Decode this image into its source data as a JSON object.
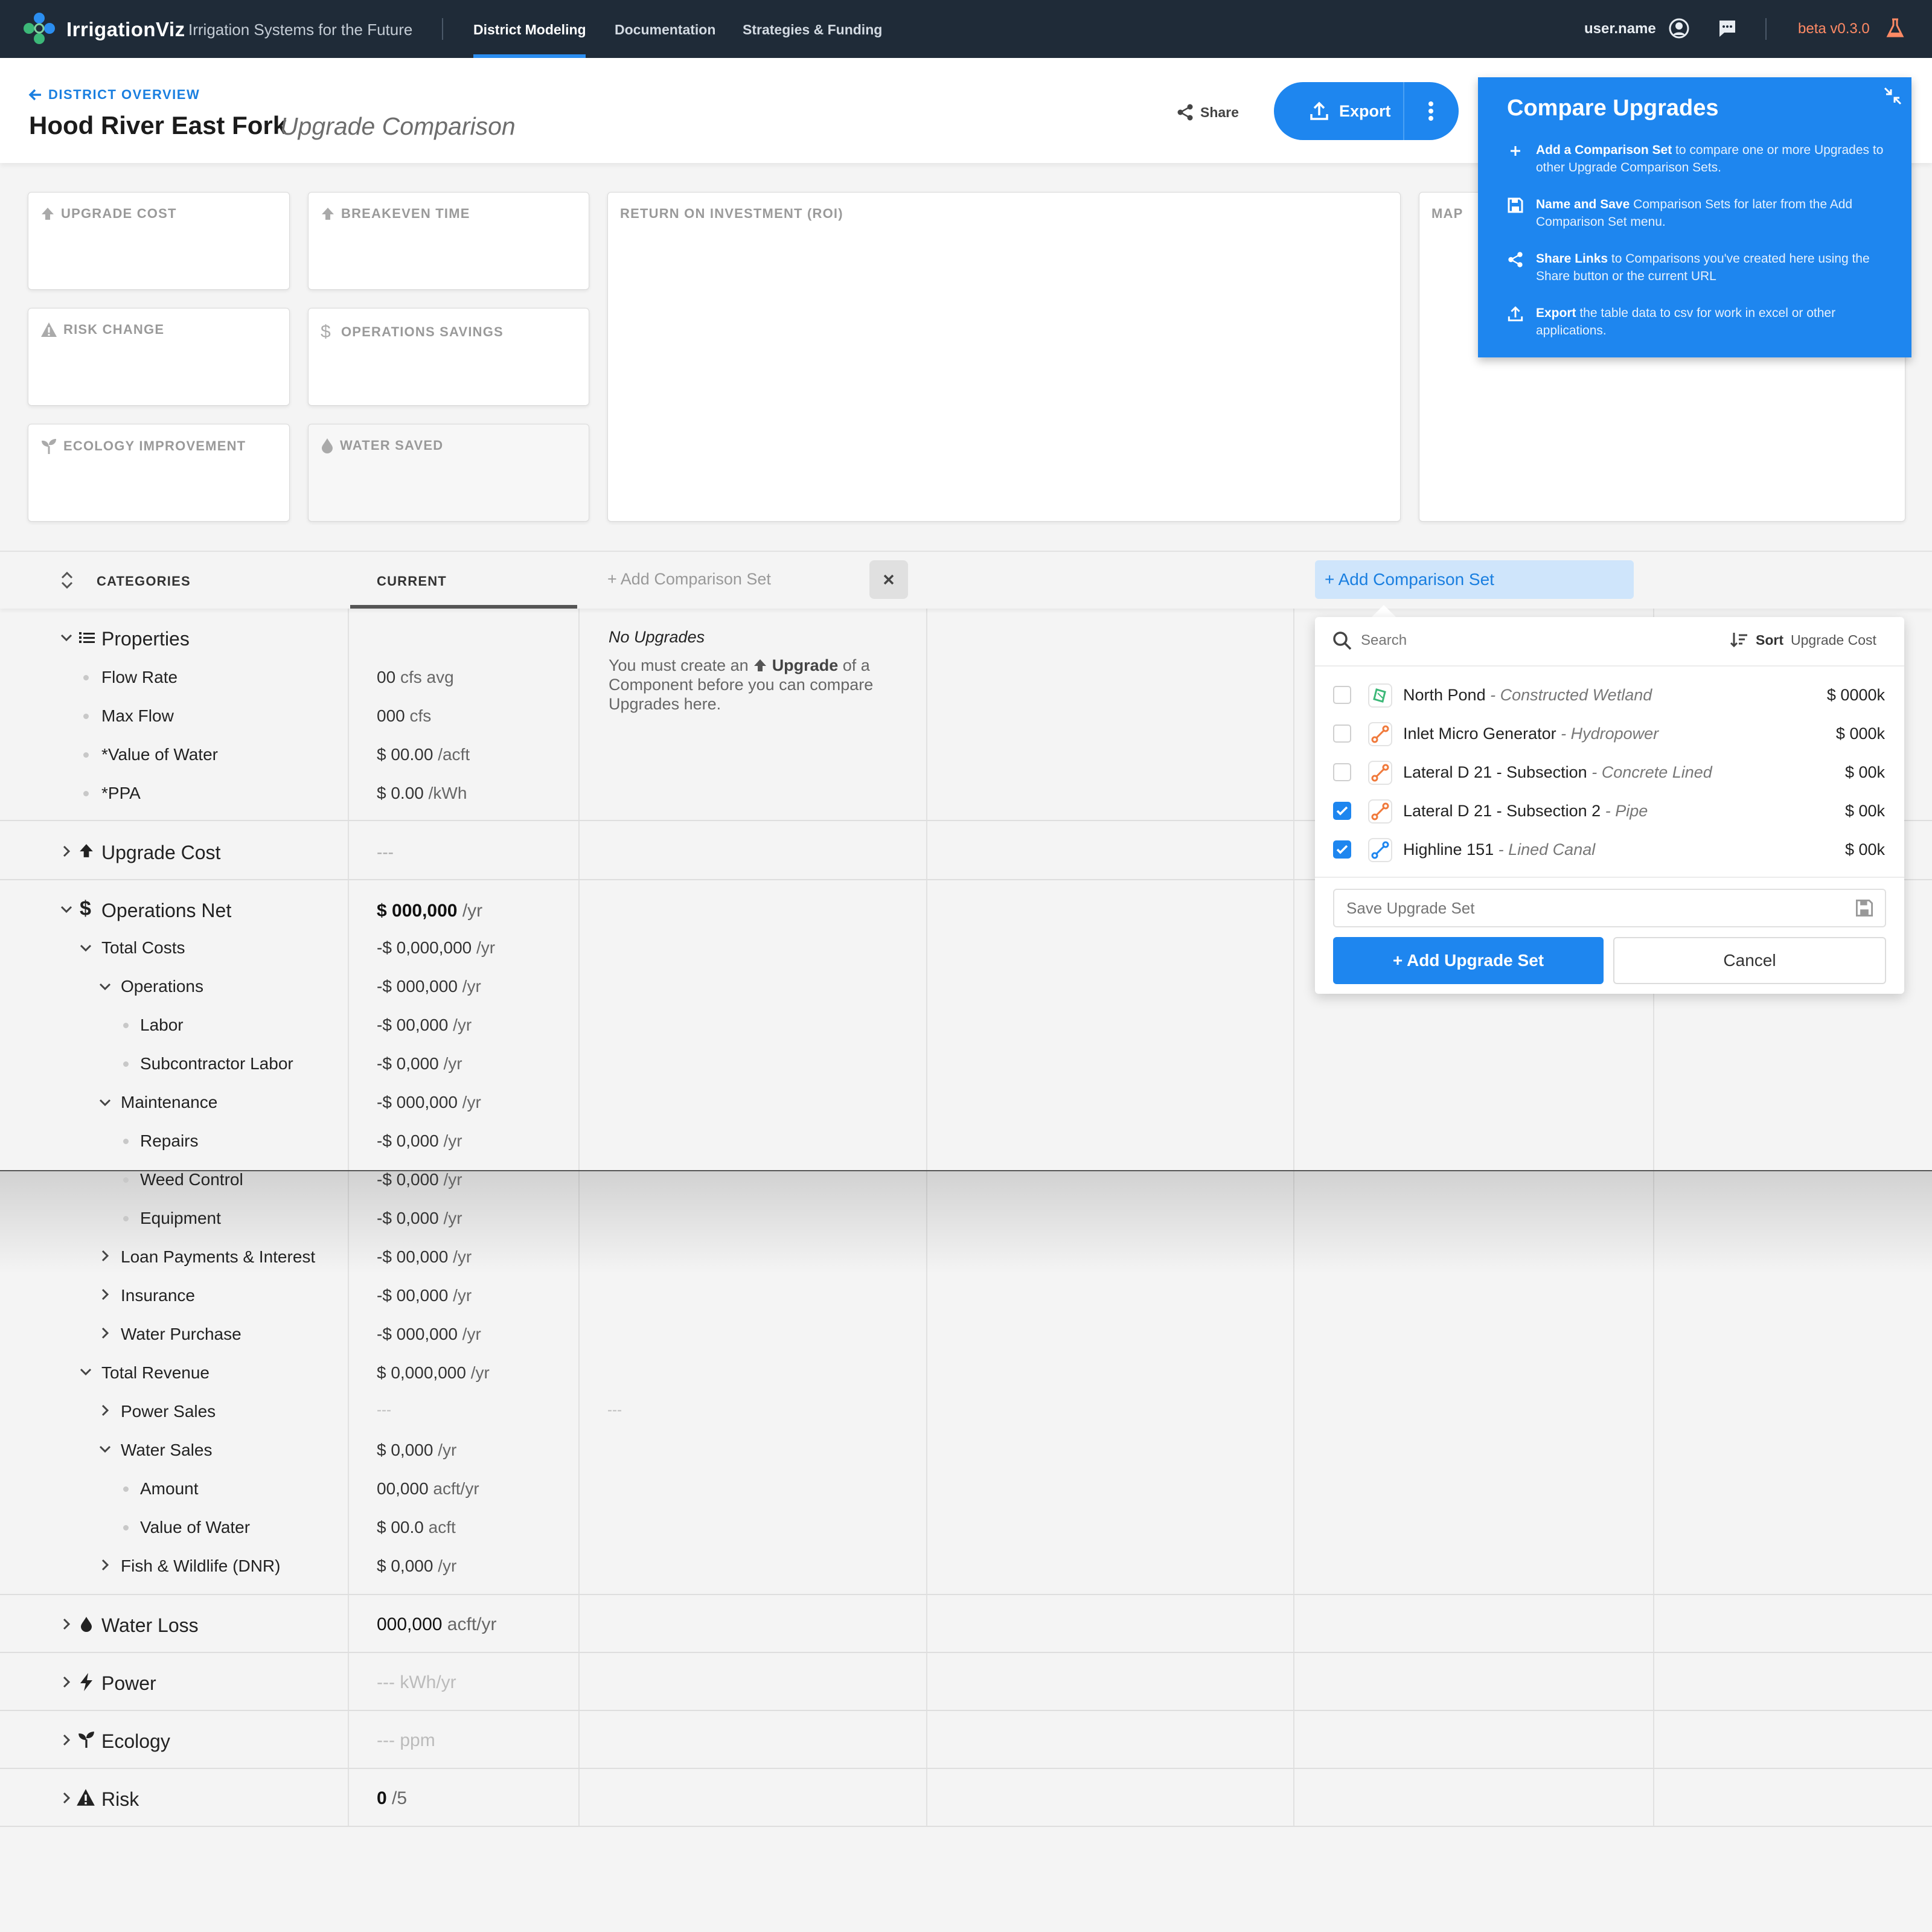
{
  "nav": {
    "brand": "IrrigationViz",
    "tagline": "Irrigation Systems for the Future",
    "links": [
      "District Modeling",
      "Documentation",
      "Strategies & Funding"
    ],
    "user": "user.name",
    "version": "beta v0.3.0"
  },
  "header": {
    "back": "DISTRICT OVERVIEW",
    "title": "Hood River East Fork",
    "subtitle": "Upgrade Comparison",
    "share": "Share",
    "export": "Export"
  },
  "cards": {
    "upgrade_cost": "UPGRADE COST",
    "breakeven": "BREAKEVEN TIME",
    "roi": "RETURN ON INVESTMENT (ROI)",
    "map": "MAP",
    "risk": "RISK CHANGE",
    "ops": "OPERATIONS SAVINGS",
    "ecology": "ECOLOGY IMPROVEMENT",
    "water": "WATER SAVED"
  },
  "compare_panel": {
    "title": "Compare Upgrades",
    "tips": [
      {
        "bold": "Add a Comparison Set",
        "text": " to compare one or more Upgrades to other Upgrade Comparison Sets."
      },
      {
        "bold": "Name and Save",
        "text": " Comparison Sets for later from the Add Comparison Set menu."
      },
      {
        "bold": "Share Links",
        "text": " to Comparisons you've created here using the Share button or the current URL"
      },
      {
        "bold": "Export",
        "text": " the table data to csv for work in excel or other applications."
      }
    ]
  },
  "table": {
    "categories_header": "CATEGORIES",
    "current_header": "CURRENT",
    "add_set_1": "+ Add Comparison Set",
    "add_set_2": "+ Add Comparison Set",
    "no_upgrades_title": "No Upgrades",
    "no_upgrades_pre": "You must create an",
    "no_upgrades_bold": "Upgrade",
    "no_upgrades_post": "of a Component before you can compare Upgrades here.",
    "col2_dash": "---",
    "rows": {
      "properties": "Properties",
      "flow_rate": "Flow Rate",
      "flow_rate_v": "00",
      "flow_rate_u": "cfs avg",
      "max_flow": "Max Flow",
      "max_flow_v": "000",
      "max_flow_u": "cfs",
      "value_water": "*Value of Water",
      "value_water_v": "$ 00.00",
      "value_water_u": "/acft",
      "ppa": "*PPA",
      "ppa_v": "$ 0.00",
      "ppa_u": "/kWh",
      "upgrade_cost": "Upgrade Cost",
      "upgrade_cost_v": "---",
      "ops_net": "Operations Net",
      "ops_net_v": "$ 000,000",
      "ops_net_u": "/yr",
      "total_costs": "Total Costs",
      "total_costs_v": "-$ 0,000,000",
      "total_costs_u": "/yr",
      "operations": "Operations",
      "operations_v": "-$ 000,000",
      "operations_u": "/yr",
      "labor": "Labor",
      "labor_v": "-$ 00,000",
      "labor_u": "/yr",
      "subcontractor": "Subcontractor Labor",
      "subcontractor_v": "-$ 0,000",
      "subcontractor_u": "/yr",
      "maintenance": "Maintenance",
      "maintenance_v": "-$ 000,000",
      "maintenance_u": "/yr",
      "repairs": "Repairs",
      "repairs_v": "-$ 0,000",
      "repairs_u": "/yr",
      "weed": "Weed Control",
      "weed_v": "-$ 0,000",
      "weed_u": "/yr",
      "equipment": "Equipment",
      "equipment_v": "-$ 0,000",
      "equipment_u": "/yr",
      "loan": "Loan Payments & Interest",
      "loan_v": "-$ 00,000",
      "loan_u": "/yr",
      "insurance": "Insurance",
      "insurance_v": "-$ 00,000",
      "insurance_u": "/yr",
      "water_purchase": "Water Purchase",
      "water_purchase_v": "-$ 000,000",
      "water_purchase_u": "/yr",
      "total_revenue": "Total Revenue",
      "total_revenue_v": "$ 0,000,000",
      "total_revenue_u": "/yr",
      "power_sales": "Power Sales",
      "power_sales_v": "---",
      "water_sales": "Water Sales",
      "water_sales_v": "$ 0,000",
      "water_sales_u": "/yr",
      "amount": "Amount",
      "amount_v": "00,000",
      "amount_u": "acft/yr",
      "value_of_water": "Value of Water",
      "value_of_water_v": "$ 00.0",
      "value_of_water_u": "acft",
      "fish": "Fish & Wildlife (DNR)",
      "fish_v": "$ 0,000",
      "fish_u": "/yr",
      "water_loss": "Water Loss",
      "water_loss_v": "000,000",
      "water_loss_u": "acft/yr",
      "power": "Power",
      "power_v": "---",
      "power_u": "kWh/yr",
      "ecology": "Ecology",
      "ecology_v": "---",
      "ecology_u": "ppm",
      "risk": "Risk",
      "risk_v": "0",
      "risk_u": "/5"
    }
  },
  "dropdown": {
    "search_placeholder": "Search",
    "sort_label": "Sort",
    "sort_value": "Upgrade Cost",
    "options": [
      {
        "name": "North Pond",
        "type": "- Constructed Wetland",
        "cost": "$  0000k",
        "checked": false
      },
      {
        "name": "Inlet Micro Generator",
        "type": "- Hydropower",
        "cost": "$  000k",
        "checked": false
      },
      {
        "name": "Lateral D 21 - Subsection",
        "type": "- Concrete Lined",
        "cost": "$  00k",
        "checked": false
      },
      {
        "name": "Lateral D 21 - Subsection 2",
        "type": "- Pipe",
        "cost": "$  00k",
        "checked": true
      },
      {
        "name": "Highline 151",
        "type": "- Lined Canal",
        "cost": "$  00k",
        "checked": true
      }
    ],
    "save_placeholder": "Save Upgrade Set",
    "add_button": "+ Add Upgrade Set",
    "cancel_button": "Cancel"
  },
  "colors": {
    "nav_bg": "#1f2b38",
    "accent": "#1e86ef",
    "beta": "#ff8a65"
  }
}
